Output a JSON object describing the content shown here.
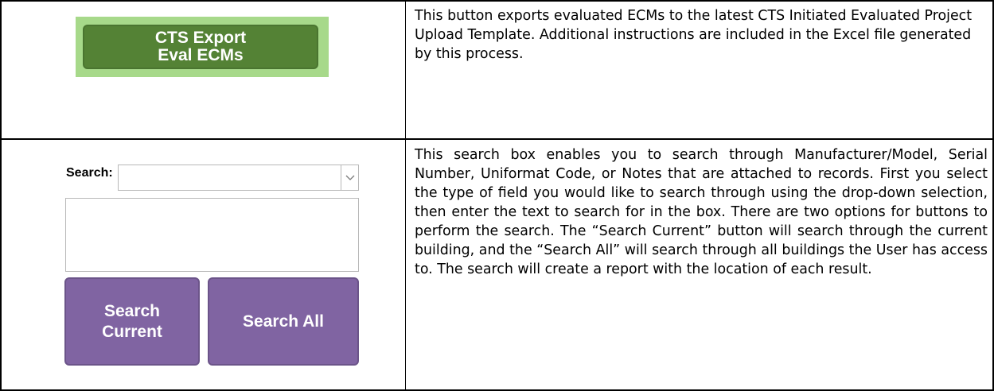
{
  "export_section": {
    "button_line1": "CTS Export",
    "button_line2": "Eval ECMs",
    "description": "This button exports evaluated ECMs to the latest CTS Initiated Evaluated Project Upload Template. Additional instructions are included in the Excel file generated by this process."
  },
  "search_section": {
    "search_label": "Search:",
    "dropdown_value": "",
    "search_text_value": "",
    "search_current_line1": "Search",
    "search_current_line2": "Current",
    "search_all_label": "Search All",
    "description": "This search box enables you to search through Manufacturer/Model, Serial Number, Uniformat Code, or Notes that are attached to records. First you select the type of field you would like to search through using the drop-down selection, then enter the text to search for in the box. There are two options for buttons to perform the search. The “Search Current” button will search through the current building, and the “Search All” will search through all buildings the User has access to. The search will create a report with the location of each result."
  },
  "colors": {
    "export_green": "#548235",
    "export_frame": "#a7d98a",
    "search_purple": "#8064a2"
  },
  "icons": {
    "dropdown": "chevron-down-icon"
  }
}
